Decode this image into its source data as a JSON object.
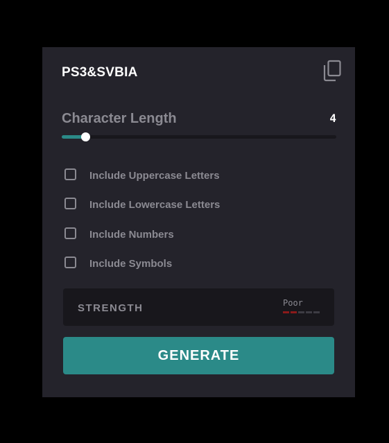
{
  "generated_password": "PS3&SVBIA",
  "copy_icon": "copy-icon",
  "length": {
    "label": "Character Length",
    "value": "4",
    "slider_fraction": 0.085
  },
  "options": [
    {
      "label": "Include Uppercase Letters",
      "checked": false
    },
    {
      "label": "Include Lowercase Letters",
      "checked": false
    },
    {
      "label": "Include Numbers",
      "checked": false
    },
    {
      "label": "Include Symbols",
      "checked": false
    }
  ],
  "strength": {
    "label": "STRENGTH",
    "rating": "Poor",
    "bars_total": 5,
    "bars_filled": 2
  },
  "generate_label": "GENERATE",
  "colors": {
    "accent": "#2b8a88",
    "card_bg": "#24232b",
    "panel_bg": "#18171c",
    "muted_text": "#8b8a92",
    "poor": "#8b1a1a"
  }
}
